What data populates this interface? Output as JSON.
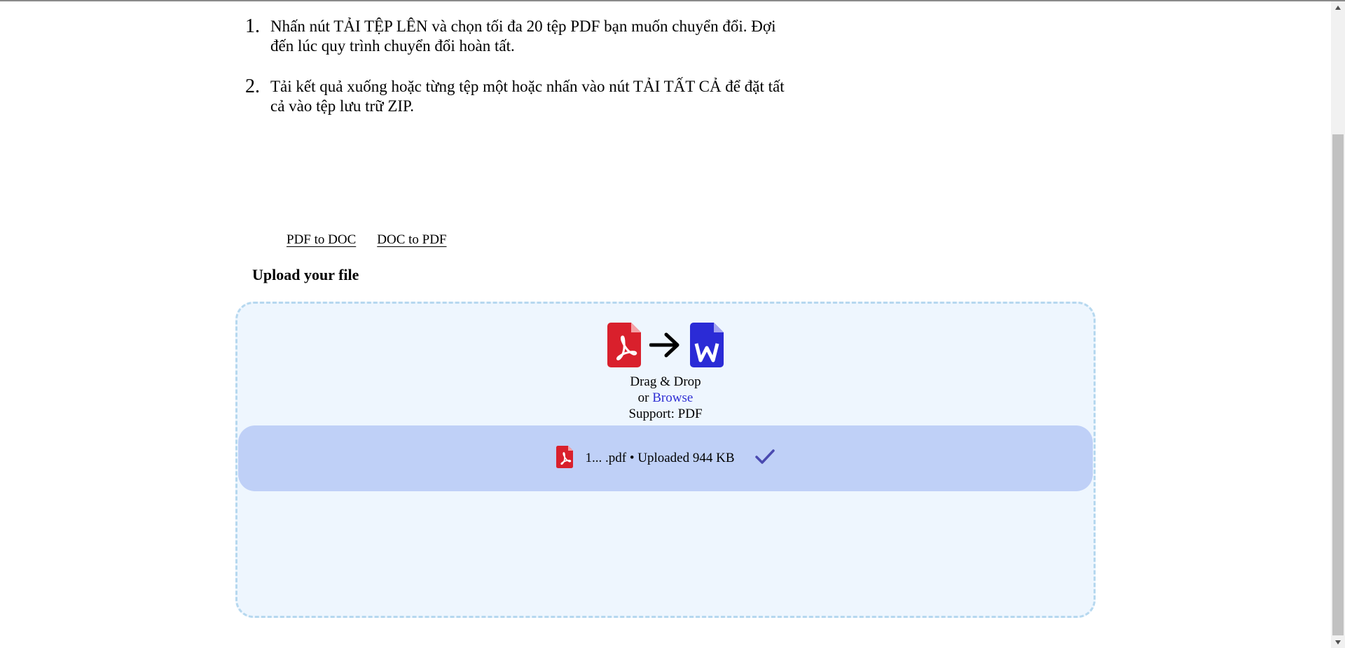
{
  "instructions": [
    {
      "num": "1.",
      "line1": "Nhấn nút TẢI TỆP LÊN và chọn tối đa 20 tệp PDF bạn muốn chuyển đổi. Đợi",
      "line2": "đến lúc quy trình chuyển đổi hoàn tất."
    },
    {
      "num": "2.",
      "line1": "Tải kết quả xuống hoặc từng tệp một hoặc nhấn vào nút TẢI TẤT CẢ để đặt tất",
      "line2": "cả vào tệp lưu trữ ZIP."
    }
  ],
  "tabs": [
    "PDF to DOC",
    "DOC to PDF"
  ],
  "upload": {
    "title": "Upload your file",
    "drag_drop": "Drag & Drop",
    "or_text": "or",
    "browse_label": "Browse",
    "support": "Support: PDF",
    "file_status": "1... .pdf • Uploaded 944 KB",
    "icons": [
      "pdf-file-icon",
      "arrow-right-icon",
      "word-file-icon",
      "checkmark-icon"
    ]
  },
  "colors": {
    "pdf_red": "#d9202c",
    "word_blue": "#2b2bd6",
    "dropzone_bg": "#eef6fe",
    "dropzone_border": "#b6d8ef",
    "file_row_bg": "#bfd0f7",
    "check": "#4a4ab0",
    "link": "#2f2fd4"
  }
}
